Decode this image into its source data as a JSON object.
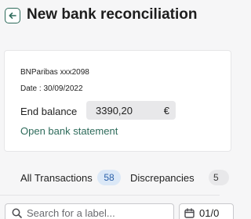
{
  "header": {
    "title": "New bank reconciliation",
    "back_icon": "arrow-left-icon"
  },
  "account_card": {
    "account": "BNParibas xxx2098",
    "date_line": "Date : 30/09/2022",
    "end_balance_label": "End balance",
    "end_balance_value": "3390,20",
    "currency": "€",
    "open_statement_link": "Open bank statement"
  },
  "tabs": [
    {
      "label": "All Transactions",
      "count": "58"
    },
    {
      "label": "Discrepancies",
      "count": "5"
    }
  ],
  "filters": {
    "search_placeholder": "Search for a label...",
    "date_value": "01/0"
  },
  "colors": {
    "accent": "#2e6b5b",
    "badge_bg": "#dbe8f7",
    "badge_text": "#2a5fa8"
  }
}
